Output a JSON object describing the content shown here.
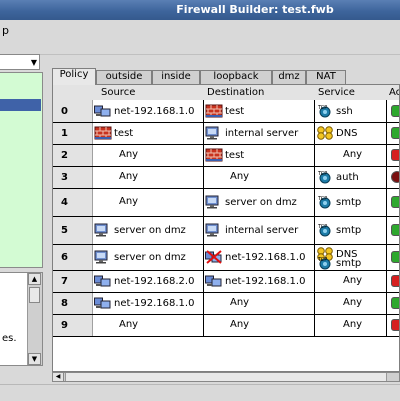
{
  "window": {
    "title": "Firewall Builder: test.fwb"
  },
  "menubar": {
    "visible_menu_fragment": "p"
  },
  "tabs": [
    "Policy",
    "outside",
    "inside",
    "loopback",
    "dmz",
    "NAT"
  ],
  "columns": {
    "num": "",
    "source": "Source",
    "destination": "Destination",
    "service": "Service",
    "action": "Ac"
  },
  "left_pane": {
    "info_text": "es."
  },
  "rules": [
    {
      "num": "0",
      "source": [
        {
          "label": "net-192.168.1.0",
          "icon": "network-icon"
        }
      ],
      "destination": [
        {
          "label": "test",
          "icon": "firewall-icon"
        }
      ],
      "service": [
        {
          "label": "ssh",
          "icon": "tcp-service-icon"
        }
      ],
      "action": "accept"
    },
    {
      "num": "1",
      "source": [
        {
          "label": "test",
          "icon": "firewall-icon"
        }
      ],
      "destination": [
        {
          "label": "internal server",
          "icon": "host-icon"
        }
      ],
      "service": [
        {
          "label": "DNS",
          "icon": "service-group-icon"
        }
      ],
      "action": "accept"
    },
    {
      "num": "2",
      "source": [
        {
          "label": "Any"
        }
      ],
      "destination": [
        {
          "label": "test",
          "icon": "firewall-icon"
        }
      ],
      "service": [
        {
          "label": "Any"
        }
      ],
      "action": "deny"
    },
    {
      "num": "3",
      "source": [
        {
          "label": "Any"
        }
      ],
      "destination": [
        {
          "label": "Any"
        }
      ],
      "service": [
        {
          "label": "auth",
          "icon": "tcp-service-icon"
        }
      ],
      "action": "reject"
    },
    {
      "num": "4",
      "source": [
        {
          "label": "Any"
        }
      ],
      "destination": [
        {
          "label": "server on dmz",
          "icon": "host-icon"
        }
      ],
      "service": [
        {
          "label": "smtp",
          "icon": "tcp-service-icon"
        }
      ],
      "action": "accept"
    },
    {
      "num": "5",
      "source": [
        {
          "label": "server on dmz",
          "icon": "host-icon"
        }
      ],
      "destination": [
        {
          "label": "internal server",
          "icon": "host-icon"
        }
      ],
      "service": [
        {
          "label": "smtp",
          "icon": "tcp-service-icon"
        }
      ],
      "action": "accept"
    },
    {
      "num": "6",
      "source": [
        {
          "label": "server on dmz",
          "icon": "host-icon"
        }
      ],
      "destination": [
        {
          "label": "net-192.168.1.0",
          "icon": "network-negated-icon"
        }
      ],
      "service": [
        {
          "label": "DNS",
          "icon": "service-group-icon"
        },
        {
          "label": "smtp",
          "icon": "tcp-service-icon"
        }
      ],
      "action": "accept"
    },
    {
      "num": "7",
      "source": [
        {
          "label": "net-192.168.2.0",
          "icon": "network-icon"
        }
      ],
      "destination": [
        {
          "label": "net-192.168.1.0",
          "icon": "network-icon"
        }
      ],
      "service": [
        {
          "label": "Any"
        }
      ],
      "action": "deny"
    },
    {
      "num": "8",
      "source": [
        {
          "label": "net-192.168.1.0",
          "icon": "network-icon"
        }
      ],
      "destination": [
        {
          "label": "Any"
        }
      ],
      "service": [
        {
          "label": "Any"
        }
      ],
      "action": "accept"
    },
    {
      "num": "9",
      "source": [
        {
          "label": "Any"
        }
      ],
      "destination": [
        {
          "label": "Any"
        }
      ],
      "service": [
        {
          "label": "Any"
        }
      ],
      "action": "deny"
    }
  ],
  "colors": {
    "accept": "#2ea82e",
    "deny": "#d62020",
    "reject": "#7a1010",
    "tree_bg": "#d3fbd3",
    "selection": "#3f62a8"
  }
}
